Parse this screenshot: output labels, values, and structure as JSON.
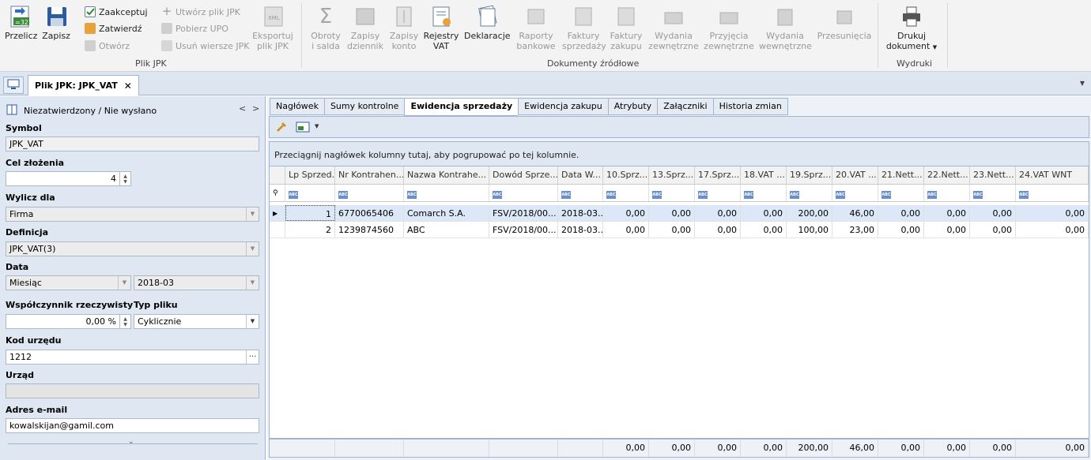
{
  "ribbon": {
    "przelicz": "Przelicz",
    "zapisz": "Zapisz",
    "zaakceptuj": "Zaakceptuj",
    "zatwierdz": "Zatwierdź",
    "otworz": "Otwórz",
    "utworz_plik": "Utwórz plik JPK",
    "pobierz_upo": "Pobierz UPO",
    "usun_wiersze": "Usuń wiersze JPK",
    "eksportuj_1": "Eksportuj",
    "eksportuj_2": "plik JPK",
    "group_plik_jpk": "Plik JPK",
    "obroty_1": "Obroty",
    "obroty_2": "i salda",
    "zapisy_dz_1": "Zapisy",
    "zapisy_dz_2": "dziennik",
    "zapisy_k_1": "Zapisy",
    "zapisy_k_2": "konto",
    "rejestry_1": "Rejestry",
    "rejestry_2": "VAT",
    "deklaracje": "Deklaracje",
    "raporty_1": "Raporty",
    "raporty_2": "bankowe",
    "faktury_s_1": "Faktury",
    "faktury_s_2": "sprzedaży",
    "faktury_z_1": "Faktury",
    "faktury_z_2": "zakupu",
    "wydania_z_1": "Wydania",
    "wydania_z_2": "zewnętrzne",
    "przyjecia_1": "Przyjęcia",
    "przyjecia_2": "zewnętrzne",
    "wydania_w_1": "Wydania",
    "wydania_w_2": "wewnętrzne",
    "przesuniecia": "Przesunięcia",
    "group_dokumenty": "Dokumenty źródłowe",
    "drukuj_1": "Drukuj",
    "drukuj_2": "dokument",
    "group_wydruki": "Wydruki"
  },
  "doc_tab": {
    "title": "Plik JPK: JPK_VAT"
  },
  "left": {
    "status": "Niezatwierdzony / Nie wysłano",
    "symbol_label": "Symbol",
    "symbol_value": "JPK_VAT",
    "cel_label": "Cel złożenia",
    "cel_value": "4",
    "wylicz_label": "Wylicz dla",
    "wylicz_value": "Firma",
    "definicja_label": "Definicja",
    "definicja_value": "JPK_VAT(3)",
    "data_label": "Data",
    "data_period": "Miesiąc",
    "data_value": "2018-03",
    "wspolczynnik_label": "Współczynnik rzeczywisty",
    "wspolczynnik_value": "0,00 %",
    "typ_label": "Typ pliku",
    "typ_value": "Cyklicznie",
    "kod_label": "Kod urzędu",
    "kod_value": "1212",
    "urzad_label": "Urząd",
    "urzad_value": "",
    "email_label": "Adres e-mail",
    "email_value": "kowalskijan@gamil.com"
  },
  "tabs": [
    "Nagłówek",
    "Sumy kontrolne",
    "Ewidencja sprzedaży",
    "Ewidencja zakupu",
    "Atrybuty",
    "Załączniki",
    "Historia zmian"
  ],
  "group_hint": "Przeciągnij nagłówek kolumny tutaj, aby pogrupować po tej kolumnie.",
  "columns": [
    "Lp Sprzed...",
    "Nr Kontrahen...",
    "Nazwa Kontrahe...",
    "Dowód Sprze...",
    "Data W...",
    "10.Sprz...",
    "13.Sprz...",
    "17.Sprz...",
    "18.VAT ...",
    "19.Sprz...",
    "20.VAT ...",
    "21.Nett...",
    "22.Nett...",
    "23.Nett...",
    "24.VAT WNT"
  ],
  "rows": [
    [
      "1",
      "6770065406",
      "Comarch S.A.",
      "FSV/2018/00...",
      "2018-03...",
      "0,00",
      "0,00",
      "0,00",
      "0,00",
      "200,00",
      "46,00",
      "0,00",
      "0,00",
      "0,00",
      "0,00"
    ],
    [
      "2",
      "1239874560",
      "ABC",
      "FSV/2018/00...",
      "2018-03...",
      "0,00",
      "0,00",
      "0,00",
      "0,00",
      "100,00",
      "23,00",
      "0,00",
      "0,00",
      "0,00",
      "0,00"
    ]
  ],
  "totals": [
    "",
    "",
    "",
    "",
    "",
    "0,00",
    "0,00",
    "0,00",
    "0,00",
    "200,00",
    "46,00",
    "0,00",
    "0,00",
    "0,00",
    "0,00"
  ]
}
